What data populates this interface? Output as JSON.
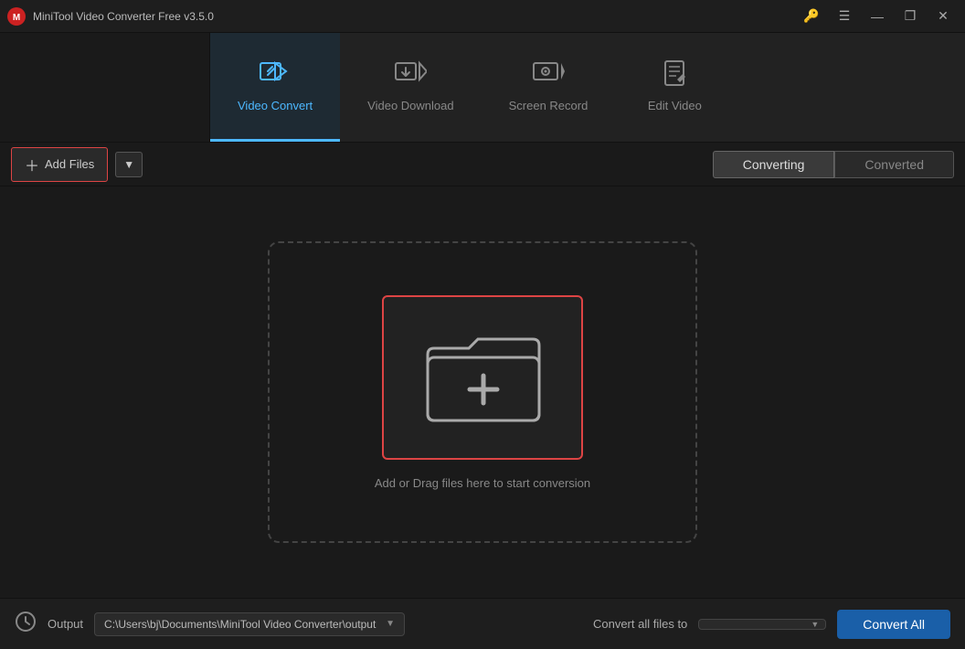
{
  "app": {
    "title": "MiniTool Video Converter Free v3.5.0"
  },
  "title_controls": {
    "key_btn": "🔑",
    "menu_btn": "☰",
    "minimize_btn": "—",
    "restore_btn": "❐",
    "close_btn": "✕"
  },
  "nav": {
    "tabs": [
      {
        "id": "video-convert",
        "label": "Video Convert",
        "active": true
      },
      {
        "id": "video-download",
        "label": "Video Download",
        "active": false
      },
      {
        "id": "screen-record",
        "label": "Screen Record",
        "active": false
      },
      {
        "id": "edit-video",
        "label": "Edit Video",
        "active": false
      }
    ]
  },
  "toolbar": {
    "add_files_label": "Add Files",
    "converting_tab": "Converting",
    "converted_tab": "Converted"
  },
  "drop_zone": {
    "hint": "Add or Drag files here to start conversion"
  },
  "status_bar": {
    "output_label": "Output",
    "output_path": "C:\\Users\\bj\\Documents\\MiniTool Video Converter\\output",
    "convert_all_label": "Convert all files to",
    "convert_btn_label": "Convert All"
  }
}
